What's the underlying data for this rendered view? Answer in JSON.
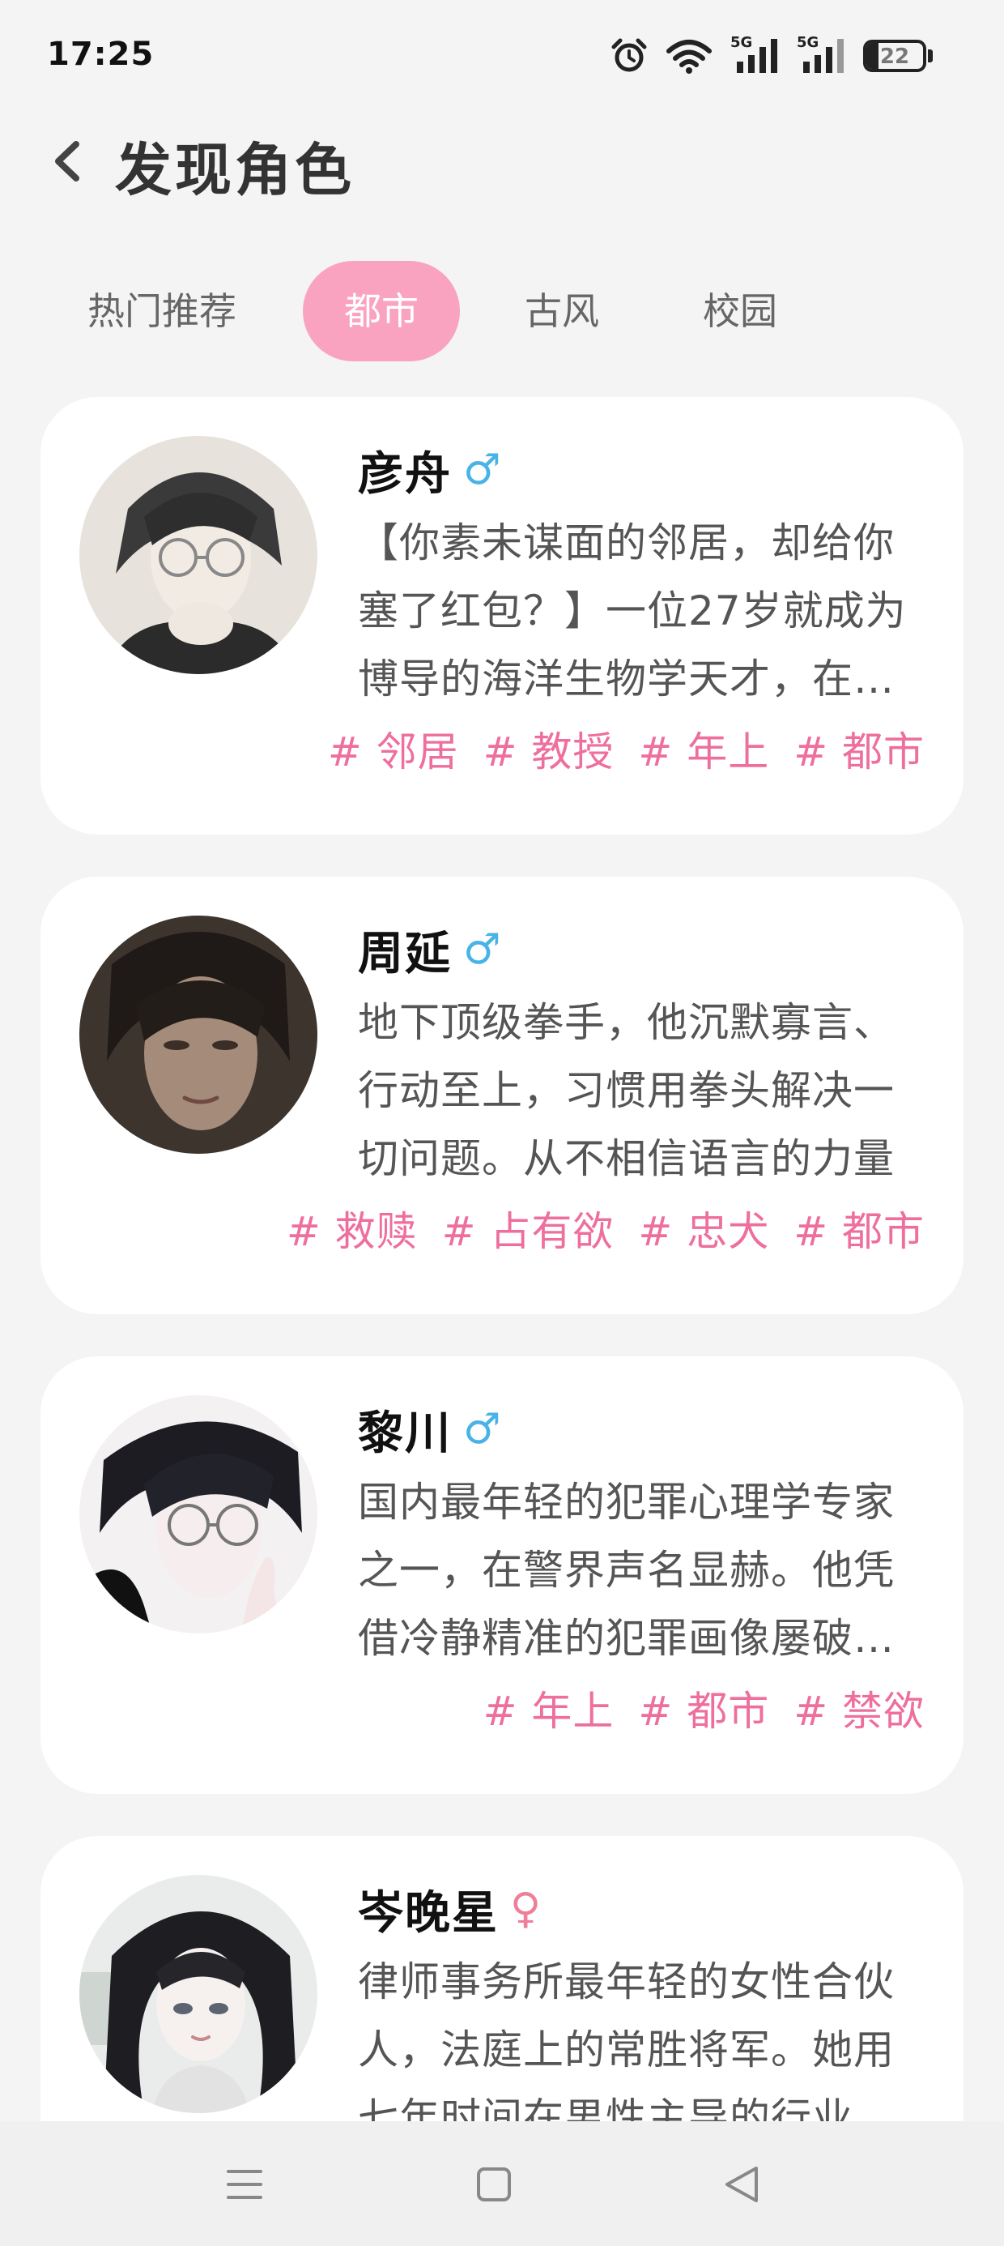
{
  "status_bar": {
    "time": "17:25",
    "battery_level": "22",
    "signal_1_label": "5G",
    "signal_2_label": "5G"
  },
  "header": {
    "title": "发现角色"
  },
  "tabs": [
    {
      "label": "热门推荐",
      "active": false
    },
    {
      "label": "都市",
      "active": true
    },
    {
      "label": "古风",
      "active": false
    },
    {
      "label": "校园",
      "active": false
    }
  ],
  "characters": [
    {
      "name": "彦舟",
      "gender": "♂",
      "description": "【你素未谋面的邻居，却给你塞了红包？】一位27岁就成为博导的海洋生物学天才，在学术界享有盛名",
      "tags": [
        "# 邻居",
        "# 教授",
        "# 年上",
        "# 都市"
      ]
    },
    {
      "name": "周延",
      "gender": "♂",
      "description": "地下顶级拳手，他沉默寡言、行动至上，习惯用拳头解决一切问题。从不相信语言的力量",
      "tags": [
        "# 救赎",
        "# 占有欲",
        "# 忠犬",
        "# 都市"
      ]
    },
    {
      "name": "黎川",
      "gender": "♂",
      "description": "国内最年轻的犯罪心理学专家之一，在警界声名显赫。他凭借冷静精准的犯罪画像屡破奇案",
      "tags": [
        "# 年上",
        "# 都市",
        "# 禁欲"
      ]
    },
    {
      "name": "岑晚星",
      "gender": "♀",
      "description": "律师事务所最年轻的女性合伙人，法庭上的常胜将军。她用七年时间在男性主导的行业中站稳脚跟",
      "tags": []
    }
  ],
  "colors": {
    "accent_pink": "#f9a3c1",
    "tag_pink": "#ee6f9d",
    "male_blue": "#48b3e6",
    "female_pink": "#ef7e98",
    "background": "#f5f4f5"
  },
  "nav_bar": {
    "icons": [
      "menu-icon",
      "home-square-icon",
      "back-triangle-icon"
    ]
  }
}
